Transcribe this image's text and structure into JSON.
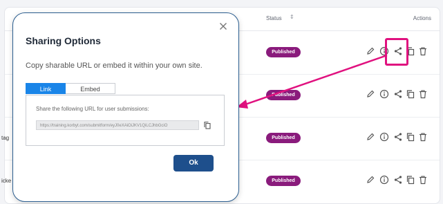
{
  "table": {
    "status_header": "Status",
    "sort_icon": "sort-icon",
    "actions_header": "Actions",
    "rows": [
      {
        "text": "",
        "status": "Published"
      },
      {
        "text": "",
        "status": "Published"
      },
      {
        "text": "tag",
        "status": "Published"
      },
      {
        "text": "icke",
        "status": "Published"
      }
    ],
    "action_icons": [
      "edit-icon",
      "info-icon",
      "share-icon",
      "copy-icon",
      "delete-icon"
    ],
    "badge_color": "#8a1b7c"
  },
  "modal": {
    "title": "Sharing Options",
    "close_icon": "close-icon",
    "description": "Copy sharable URL or embed it within your own site.",
    "tabs": {
      "link": "Link",
      "embed": "Embed"
    },
    "panel_label": "Share the following URL for user submissions:",
    "url_value": "https://training.korbyt.com/submitform/eyJ0eXAiOiJKV1QiLCJhbGciO",
    "ok_label": "Ok"
  },
  "annotation": {
    "highlight_color": "#e0117f"
  }
}
